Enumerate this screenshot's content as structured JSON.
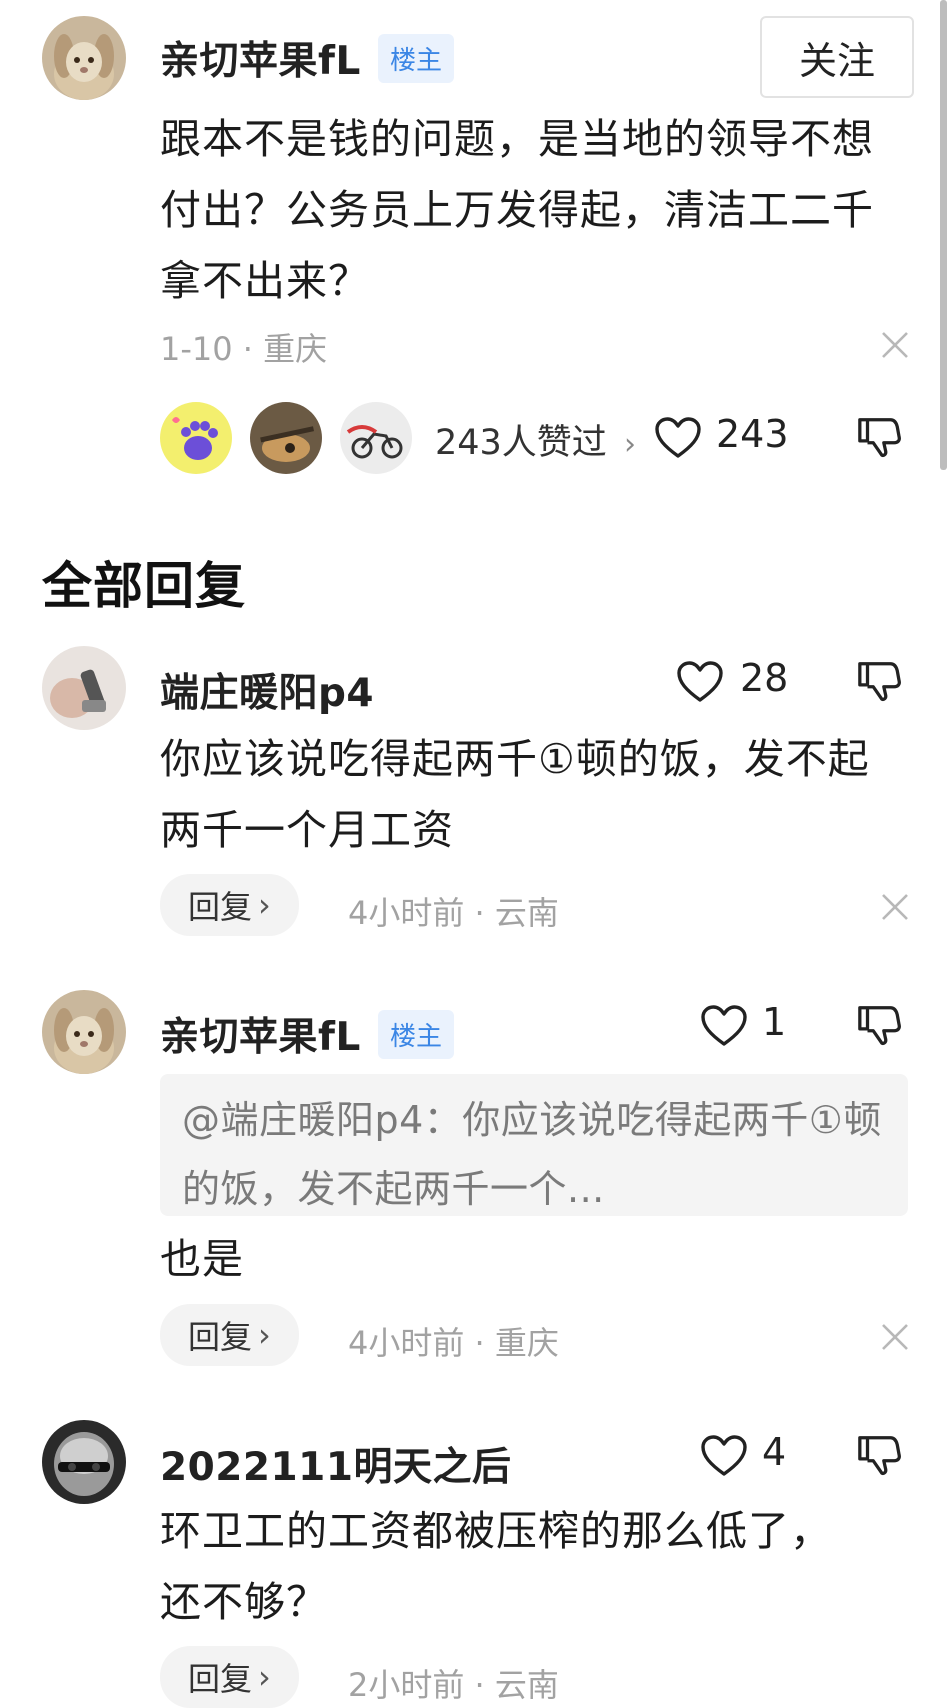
{
  "colors": {
    "accent": "#3b86e5",
    "badge_bg": "#eaf2fd",
    "meta": "#a2a2a2",
    "pill_bg": "#f3f3f3"
  },
  "main_post": {
    "username": "亲切苹果fL",
    "badge": "楼主",
    "follow_label": "关注",
    "text": "跟本不是钱的问题，是当地的领导不想付出？公务员上万发得起，清洁工二千拿不出来？",
    "meta": "1-10 · 重庆",
    "liked_by_text": "243人赞过",
    "like_count": "243",
    "liker_avatars": [
      "paw-avatar",
      "guitar-avatar",
      "motorcycle-avatar"
    ]
  },
  "section_title": "全部回复",
  "replies": [
    {
      "username": "端庄暖阳p4",
      "text": "你应该说吃得起两千①顿的饭，发不起两千一个月工资",
      "like_count": "28",
      "reply_label": "回复",
      "meta": "4小时前 · 云南"
    },
    {
      "username": "亲切苹果fL",
      "badge": "楼主",
      "quote": "@端庄暖阳p4：你应该说吃得起两千①顿的饭，发不起两千一个...",
      "text": "也是",
      "like_count": "1",
      "reply_label": "回复",
      "meta": "4小时前 · 重庆"
    },
    {
      "username": "2022111明天之后",
      "text": "环卫工的工资都被压榨的那么低了，还不够？",
      "like_count": "4",
      "reply_label": "回复",
      "meta": "2小时前 · 云南"
    }
  ]
}
